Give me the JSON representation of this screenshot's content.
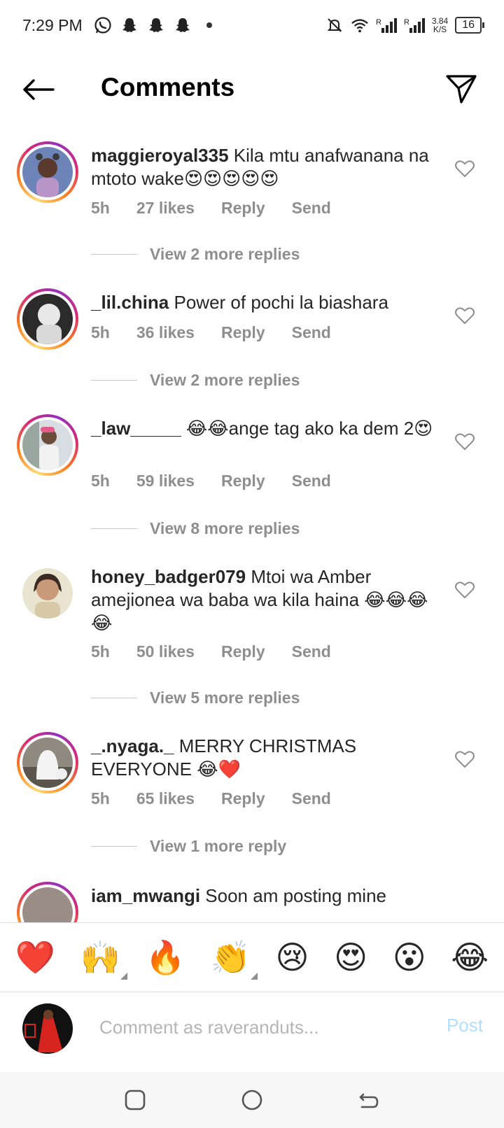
{
  "status_bar": {
    "time": "7:29 PM",
    "net_speed_value": "3.84",
    "net_speed_unit": "K/S",
    "battery": "16",
    "signal_label_1": "R",
    "signal_label_2": "R",
    "icons": [
      "whatsapp-icon",
      "snapchat-icon",
      "snapchat-icon",
      "snapchat-icon",
      "dot-icon",
      "bell-off-icon",
      "wifi-icon",
      "signal-icon",
      "signal-icon"
    ]
  },
  "header": {
    "title": "Comments",
    "back_icon": "arrow-left-icon",
    "send_icon": "paper-plane-icon"
  },
  "comments": [
    {
      "username": "maggieroyal335",
      "text": "Kila mtu anafwanana na mtoto wake😍😍😍😍😍",
      "time": "5h",
      "likes": "27 likes",
      "reply": "Reply",
      "send": "Send",
      "view_replies": "View 2 more replies",
      "has_story": true
    },
    {
      "username": "_lil.china",
      "text": "Power of pochi la biashara",
      "time": "5h",
      "likes": "36 likes",
      "reply": "Reply",
      "send": "Send",
      "view_replies": "View 2 more replies",
      "has_story": true
    },
    {
      "username": "_law_____",
      "text": "😂😂ange tag ako ka dem 2😍",
      "time": "5h",
      "likes": "59 likes",
      "reply": "Reply",
      "send": "Send",
      "view_replies": "View 8 more replies",
      "has_story": true
    },
    {
      "username": "honey_badger079",
      "text": "Mtoi wa Amber amejionea wa baba wa kila haina 😂😂😂😂",
      "time": "5h",
      "likes": "50 likes",
      "reply": "Reply",
      "send": "Send",
      "view_replies": "View 5 more replies",
      "has_story": false
    },
    {
      "username": "_.nyaga._",
      "text": "MERRY CHRISTMAS EVERYONE 😂❤️",
      "time": "5h",
      "likes": "65 likes",
      "reply": "Reply",
      "send": "Send",
      "view_replies": "View 1 more reply",
      "has_story": true
    },
    {
      "username": "iam_mwangi",
      "text": "Soon am posting mine"
    }
  ],
  "emoji_bar": [
    "❤️",
    "🙌",
    "🔥",
    "👏",
    "😢",
    "😍",
    "😮",
    "😂"
  ],
  "composer": {
    "placeholder": "Comment as raveranduts...",
    "post_label": "Post"
  },
  "nav_bar": {
    "icons": [
      "recents-square-icon",
      "home-circle-icon",
      "back-arrow-icon"
    ]
  },
  "colors": {
    "text": "#262626",
    "muted": "#8e8e8e",
    "post_disabled": "#b2dffc",
    "story_ring": [
      "#feda75",
      "#fa7e1e",
      "#d62976",
      "#962fbf"
    ]
  }
}
